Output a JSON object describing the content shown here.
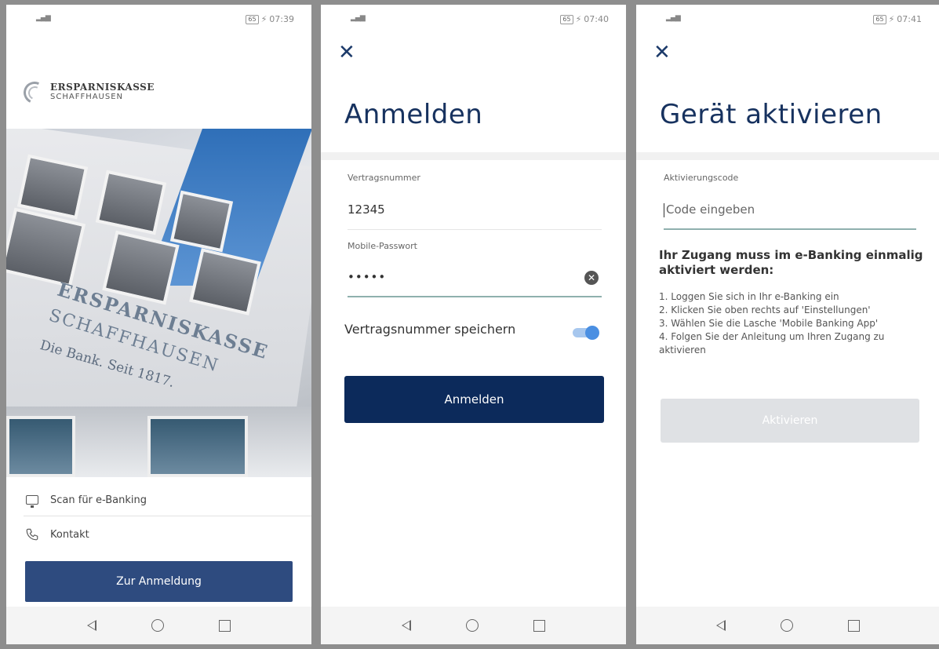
{
  "screen1": {
    "time": "07:39",
    "battery": "65",
    "brand_line1": "ERSPARNISKASSE",
    "brand_line2": "SCHAFFHAUSEN",
    "photo_sign_line1": "ERSPARNISKASSE",
    "photo_sign_line2": "SCHAFFHAUSEN",
    "photo_sign_line3": "Die Bank. Seit 1817.",
    "menu": [
      {
        "label": "Scan für e-Banking",
        "icon": "monitor-icon"
      },
      {
        "label": "Kontakt",
        "icon": "phone-icon"
      }
    ],
    "login_button": "Zur Anmeldung"
  },
  "screen2": {
    "time": "07:40",
    "battery": "65",
    "title": "Anmelden",
    "contract_label": "Vertragsnummer",
    "contract_value": "12345",
    "password_label": "Mobile-Passwort",
    "password_value": "•••••",
    "save_toggle_label": "Vertragsnummer speichern",
    "save_toggle_on": true,
    "submit_button": "Anmelden"
  },
  "screen3": {
    "time": "07:41",
    "battery": "65",
    "title": "Gerät aktivieren",
    "code_label": "Aktivierungscode",
    "code_placeholder": "Code eingeben",
    "info_title": "Ihr Zugang muss im e-Banking einmalig aktiviert werden:",
    "steps": [
      "1. Loggen Sie sich in Ihr e-Banking ein",
      "2. Klicken Sie oben rechts auf 'Einstellungen'",
      "3. Wählen Sie die Lasche 'Mobile Banking App'",
      "4. Folgen Sie der Anleitung um Ihren Zugang zu aktivieren"
    ],
    "activate_button": "Aktivieren"
  },
  "colors": {
    "primary_button": "#2e4b7f",
    "dark_button": "#0c2a5b",
    "disabled_button": "#dfe1e4",
    "title": "#17325f",
    "toggle_on": "#4a8fe2"
  }
}
